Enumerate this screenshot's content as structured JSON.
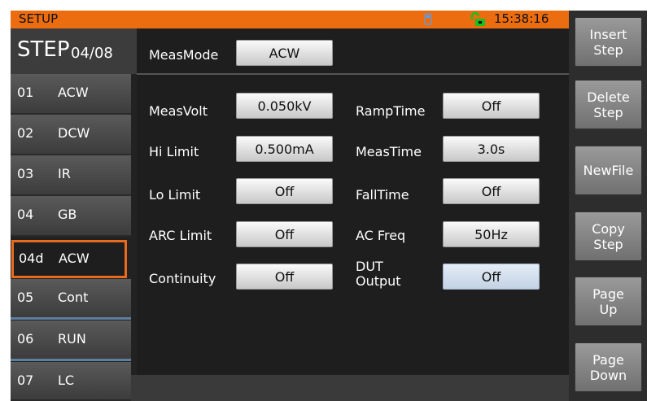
{
  "header": {
    "title": "SETUP",
    "time": "15:38:16",
    "usb_icon": "usb-drive-icon",
    "lock_icon": "unlock-icon",
    "accent": "#ec6c10"
  },
  "step": {
    "label": "STEP",
    "counter": "04/08"
  },
  "sidebar": {
    "items": [
      {
        "num": "01",
        "name": "ACW"
      },
      {
        "num": "02",
        "name": "DCW"
      },
      {
        "num": "03",
        "name": "IR"
      },
      {
        "num": "04",
        "name": "GB"
      },
      {
        "num": "04d",
        "name": "ACW",
        "selected": true
      },
      {
        "num": "05",
        "name": "Cont"
      },
      {
        "num": "06",
        "name": "RUN"
      },
      {
        "num": "07",
        "name": "LC"
      }
    ]
  },
  "main": {
    "meas_mode": {
      "label": "MeasMode",
      "value": "ACW"
    },
    "left_params": [
      {
        "label": "MeasVolt",
        "value": "0.050kV"
      },
      {
        "label": "Hi Limit",
        "value": "0.500mA"
      },
      {
        "label": "Lo Limit",
        "value": "Off"
      },
      {
        "label": "ARC Limit",
        "value": "Off"
      },
      {
        "label": "Continuity",
        "value": "Off"
      }
    ],
    "right_params": [
      {
        "label": "RampTime",
        "value": "Off"
      },
      {
        "label": "MeasTime",
        "value": "3.0s"
      },
      {
        "label": "FallTime",
        "value": "Off"
      },
      {
        "label": "AC Freq",
        "value": "50Hz"
      },
      {
        "label_line1": "DUT",
        "label_line2": "Output",
        "value": "Off"
      }
    ]
  },
  "softkeys": [
    {
      "label": "Insert\nStep"
    },
    {
      "label": "Delete\nStep"
    },
    {
      "label": "NewFile"
    },
    {
      "label": "Copy\nStep"
    },
    {
      "label": "Page\nUp"
    },
    {
      "label": "Page\nDown"
    }
  ]
}
